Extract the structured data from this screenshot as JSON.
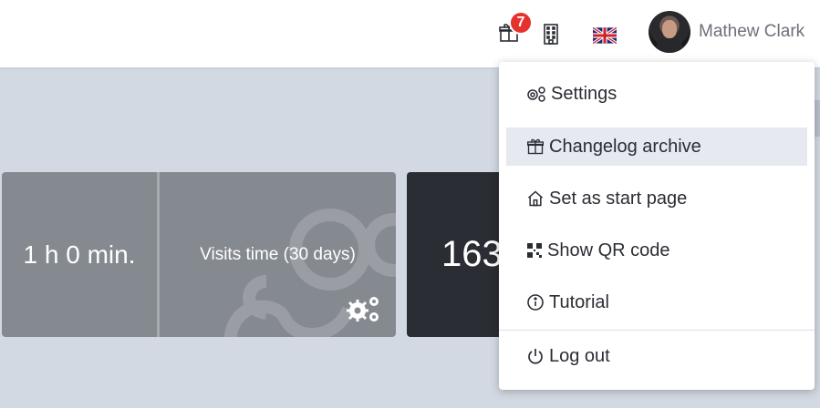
{
  "header": {
    "notification_count": "7",
    "user_name": "Mathew Clark",
    "language_flag": "uk-flag-icon"
  },
  "cards": {
    "visits_time_value": "1 h 0 min.",
    "visits_time_label": "Visits time (30 days)",
    "second_value": "163"
  },
  "user_menu": {
    "items": [
      {
        "label": "Settings",
        "icon": "gears-icon"
      },
      {
        "label": "Changelog archive",
        "icon": "gift-icon"
      },
      {
        "label": "Set as start page",
        "icon": "home-icon"
      },
      {
        "label": "Show QR code",
        "icon": "qr-code-icon"
      },
      {
        "label": "Tutorial",
        "icon": "info-icon"
      },
      {
        "label": "Log out",
        "icon": "power-icon"
      }
    ],
    "highlighted_item": "Changelog archive"
  },
  "colors": {
    "badge": "#e5322d",
    "card_gray": "#858a91",
    "card_dark": "#2a2d33",
    "background": "#d3d9e2"
  }
}
